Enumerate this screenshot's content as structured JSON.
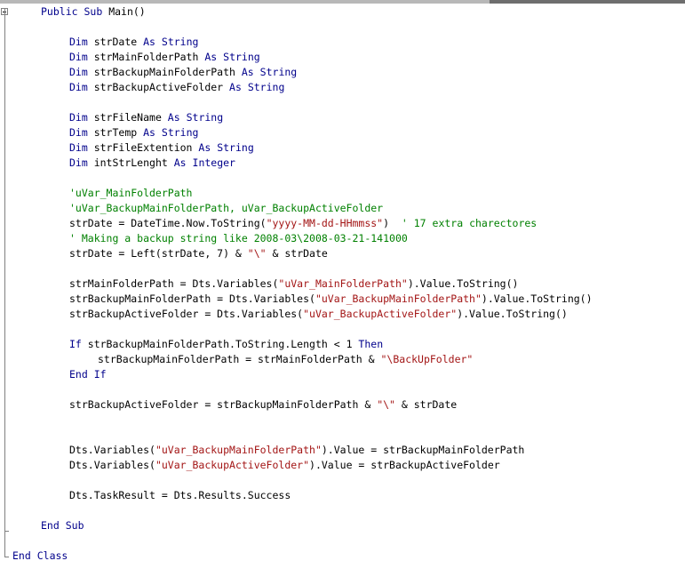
{
  "colors": {
    "keyword": "#00008b",
    "string": "#a31515",
    "comment": "#008000",
    "text": "#000000",
    "gutter": "#808080"
  },
  "gutter": {
    "collapse_icon": "minus-box-icon"
  },
  "lines": [
    {
      "n": 1,
      "indent": 1,
      "tokens": [
        {
          "t": "kw",
          "v": "Public"
        },
        {
          "t": "tx",
          "v": " "
        },
        {
          "t": "kw",
          "v": "Sub"
        },
        {
          "t": "tx",
          "v": " Main()"
        }
      ]
    },
    {
      "n": 3,
      "indent": 2,
      "tokens": [
        {
          "t": "kw",
          "v": "Dim"
        },
        {
          "t": "tx",
          "v": " strDate "
        },
        {
          "t": "kw",
          "v": "As"
        },
        {
          "t": "tx",
          "v": " "
        },
        {
          "t": "kw",
          "v": "String"
        }
      ]
    },
    {
      "n": 4,
      "indent": 2,
      "tokens": [
        {
          "t": "kw",
          "v": "Dim"
        },
        {
          "t": "tx",
          "v": " strMainFolderPath "
        },
        {
          "t": "kw",
          "v": "As"
        },
        {
          "t": "tx",
          "v": " "
        },
        {
          "t": "kw",
          "v": "String"
        }
      ]
    },
    {
      "n": 5,
      "indent": 2,
      "tokens": [
        {
          "t": "kw",
          "v": "Dim"
        },
        {
          "t": "tx",
          "v": " strBackupMainFolderPath "
        },
        {
          "t": "kw",
          "v": "As"
        },
        {
          "t": "tx",
          "v": " "
        },
        {
          "t": "kw",
          "v": "String"
        }
      ]
    },
    {
      "n": 6,
      "indent": 2,
      "tokens": [
        {
          "t": "kw",
          "v": "Dim"
        },
        {
          "t": "tx",
          "v": " strBackupActiveFolder "
        },
        {
          "t": "kw",
          "v": "As"
        },
        {
          "t": "tx",
          "v": " "
        },
        {
          "t": "kw",
          "v": "String"
        }
      ]
    },
    {
      "n": 8,
      "indent": 2,
      "tokens": [
        {
          "t": "kw",
          "v": "Dim"
        },
        {
          "t": "tx",
          "v": " strFileName "
        },
        {
          "t": "kw",
          "v": "As"
        },
        {
          "t": "tx",
          "v": " "
        },
        {
          "t": "kw",
          "v": "String"
        }
      ]
    },
    {
      "n": 9,
      "indent": 2,
      "tokens": [
        {
          "t": "kw",
          "v": "Dim"
        },
        {
          "t": "tx",
          "v": " strTemp "
        },
        {
          "t": "kw",
          "v": "As"
        },
        {
          "t": "tx",
          "v": " "
        },
        {
          "t": "kw",
          "v": "String"
        }
      ]
    },
    {
      "n": 10,
      "indent": 2,
      "tokens": [
        {
          "t": "kw",
          "v": "Dim"
        },
        {
          "t": "tx",
          "v": " strFileExtention "
        },
        {
          "t": "kw",
          "v": "As"
        },
        {
          "t": "tx",
          "v": " "
        },
        {
          "t": "kw",
          "v": "String"
        }
      ]
    },
    {
      "n": 11,
      "indent": 2,
      "tokens": [
        {
          "t": "kw",
          "v": "Dim"
        },
        {
          "t": "tx",
          "v": " intStrLenght "
        },
        {
          "t": "kw",
          "v": "As"
        },
        {
          "t": "tx",
          "v": " "
        },
        {
          "t": "kw",
          "v": "Integer"
        }
      ]
    },
    {
      "n": 13,
      "indent": 2,
      "tokens": [
        {
          "t": "cm",
          "v": "'uVar_MainFolderPath"
        }
      ]
    },
    {
      "n": 14,
      "indent": 2,
      "tokens": [
        {
          "t": "cm",
          "v": "'uVar_BackupMainFolderPath, uVar_BackupActiveFolder"
        }
      ]
    },
    {
      "n": 15,
      "indent": 2,
      "tokens": [
        {
          "t": "tx",
          "v": "strDate = DateTime.Now.ToString("
        },
        {
          "t": "str",
          "v": "\"yyyy-MM-dd-HHmmss\""
        },
        {
          "t": "tx",
          "v": ")  "
        },
        {
          "t": "cm",
          "v": "' 17 extra charectores"
        }
      ]
    },
    {
      "n": 16,
      "indent": 2,
      "tokens": [
        {
          "t": "cm",
          "v": "' Making a backup string like 2008-03\\2008-03-21-141000"
        }
      ]
    },
    {
      "n": 17,
      "indent": 2,
      "tokens": [
        {
          "t": "tx",
          "v": "strDate = Left(strDate, 7) & "
        },
        {
          "t": "str",
          "v": "\"\\\""
        },
        {
          "t": "tx",
          "v": " & strDate"
        }
      ]
    },
    {
      "n": 19,
      "indent": 2,
      "tokens": [
        {
          "t": "tx",
          "v": "strMainFolderPath = Dts.Variables("
        },
        {
          "t": "str",
          "v": "\"uVar_MainFolderPath\""
        },
        {
          "t": "tx",
          "v": ").Value.ToString()"
        }
      ]
    },
    {
      "n": 20,
      "indent": 2,
      "tokens": [
        {
          "t": "tx",
          "v": "strBackupMainFolderPath = Dts.Variables("
        },
        {
          "t": "str",
          "v": "\"uVar_BackupMainFolderPath\""
        },
        {
          "t": "tx",
          "v": ").Value.ToString()"
        }
      ]
    },
    {
      "n": 21,
      "indent": 2,
      "tokens": [
        {
          "t": "tx",
          "v": "strBackupActiveFolder = Dts.Variables("
        },
        {
          "t": "str",
          "v": "\"uVar_BackupActiveFolder\""
        },
        {
          "t": "tx",
          "v": ").Value.ToString()"
        }
      ]
    },
    {
      "n": 23,
      "indent": 2,
      "tokens": [
        {
          "t": "kw",
          "v": "If"
        },
        {
          "t": "tx",
          "v": " strBackupMainFolderPath.ToString.Length < 1 "
        },
        {
          "t": "kw",
          "v": "Then"
        }
      ]
    },
    {
      "n": 24,
      "indent": 3,
      "tokens": [
        {
          "t": "tx",
          "v": "strBackupMainFolderPath = strMainFolderPath & "
        },
        {
          "t": "str",
          "v": "\"\\BackUpFolder\""
        }
      ]
    },
    {
      "n": 25,
      "indent": 2,
      "tokens": [
        {
          "t": "kw",
          "v": "End"
        },
        {
          "t": "tx",
          "v": " "
        },
        {
          "t": "kw",
          "v": "If"
        }
      ]
    },
    {
      "n": 27,
      "indent": 2,
      "tokens": [
        {
          "t": "tx",
          "v": "strBackupActiveFolder = strBackupMainFolderPath & "
        },
        {
          "t": "str",
          "v": "\"\\\""
        },
        {
          "t": "tx",
          "v": " & strDate"
        }
      ]
    },
    {
      "n": 30,
      "indent": 2,
      "tokens": [
        {
          "t": "tx",
          "v": "Dts.Variables("
        },
        {
          "t": "str",
          "v": "\"uVar_BackupMainFolderPath\""
        },
        {
          "t": "tx",
          "v": ").Value = strBackupMainFolderPath"
        }
      ]
    },
    {
      "n": 31,
      "indent": 2,
      "tokens": [
        {
          "t": "tx",
          "v": "Dts.Variables("
        },
        {
          "t": "str",
          "v": "\"uVar_BackupActiveFolder\""
        },
        {
          "t": "tx",
          "v": ").Value = strBackupActiveFolder"
        }
      ]
    },
    {
      "n": 33,
      "indent": 2,
      "tokens": [
        {
          "t": "tx",
          "v": "Dts.TaskResult = Dts.Results.Success"
        }
      ]
    },
    {
      "n": 35,
      "indent": 1,
      "tokens": [
        {
          "t": "kw",
          "v": "End"
        },
        {
          "t": "tx",
          "v": " "
        },
        {
          "t": "kw",
          "v": "Sub"
        }
      ]
    },
    {
      "n": 37,
      "indent": 0,
      "tokens": [
        {
          "t": "kw",
          "v": "End"
        },
        {
          "t": "tx",
          "v": " "
        },
        {
          "t": "kw",
          "v": "Class"
        }
      ]
    }
  ]
}
